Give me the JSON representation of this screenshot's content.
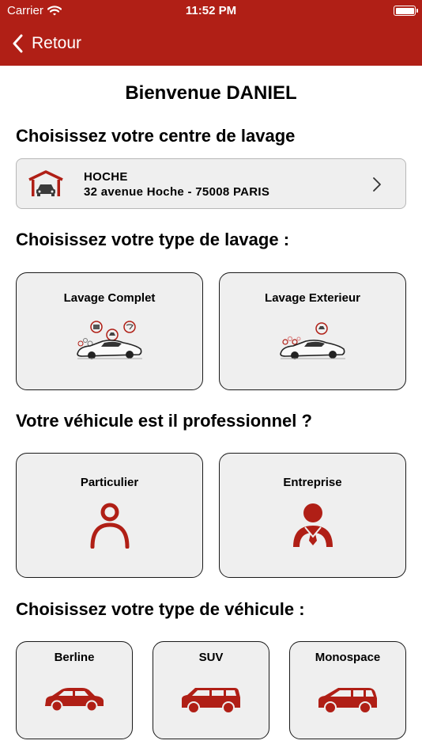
{
  "status_bar": {
    "carrier": "Carrier",
    "time": "11:52 PM"
  },
  "nav": {
    "back_label": "Retour"
  },
  "welcome": "Bienvenue DANIEL",
  "sections": {
    "center": "Choisissez votre centre de lavage",
    "wash_type": "Choisissez votre type de lavage :",
    "professional": "Votre véhicule est il professionnel ?",
    "vehicle_type": "Choisissez votre type de véhicule :"
  },
  "center": {
    "name": "HOCHE",
    "address": "32 avenue Hoche - 75008 PARIS"
  },
  "wash_types": [
    {
      "label": "Lavage Complet"
    },
    {
      "label": "Lavage Exterieur"
    }
  ],
  "customer_types": [
    {
      "label": "Particulier"
    },
    {
      "label": "Entreprise"
    }
  ],
  "vehicle_types": [
    {
      "label": "Berline"
    },
    {
      "label": "SUV"
    },
    {
      "label": "Monospace"
    }
  ],
  "colors": {
    "brand_red": "#b01f16",
    "tile_bg": "#efefef"
  },
  "icons": {
    "back": "chevron-left-icon",
    "garage": "garage-icon",
    "disclosure": "chevron-right-icon",
    "wash_complete": "car-wash-complete-icon",
    "wash_exterior": "car-wash-exterior-icon",
    "individual": "person-icon",
    "company": "person-tie-icon",
    "sedan": "sedan-icon",
    "suv": "suv-icon",
    "minivan": "minivan-icon"
  }
}
